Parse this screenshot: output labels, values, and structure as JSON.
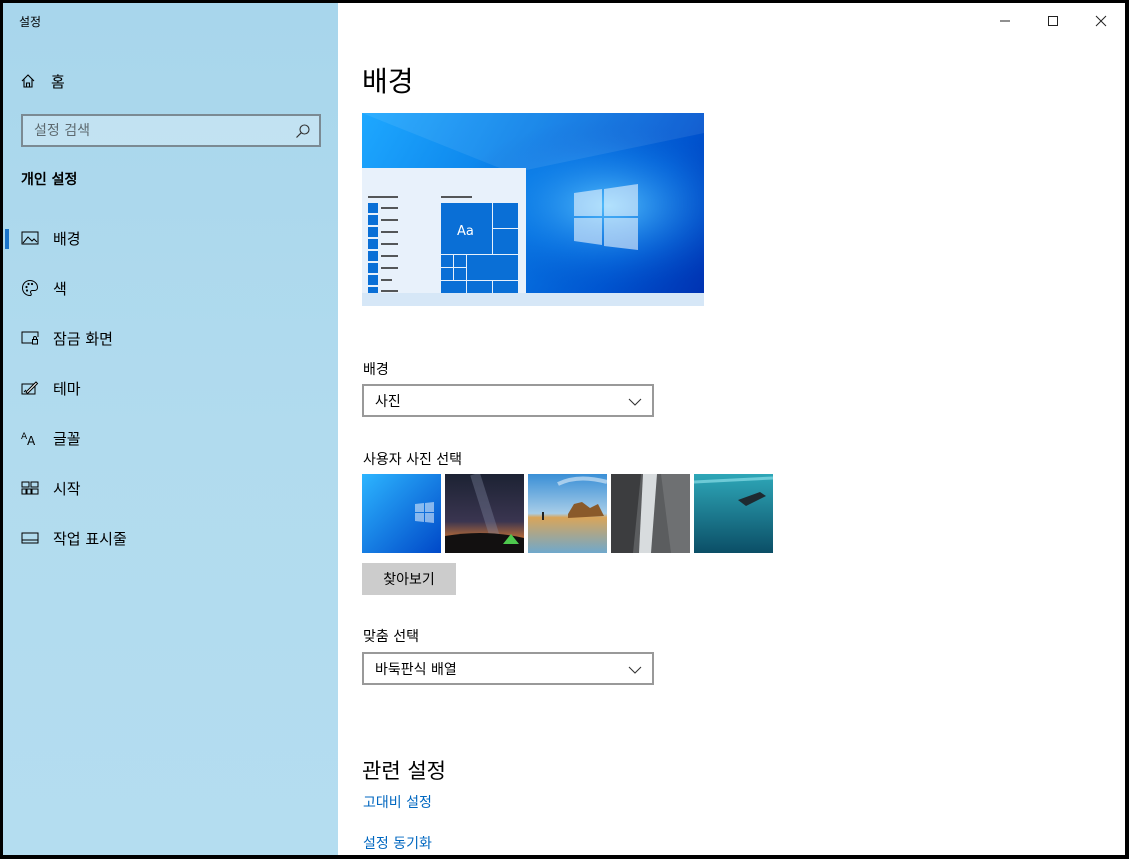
{
  "window": {
    "app_title": "설정",
    "minimize_glyph": "—",
    "maximize_glyph": "☐",
    "close_glyph": "✕"
  },
  "sidebar": {
    "home_label": "홈",
    "search_placeholder": "설정 검색",
    "section_title": "개인 설정",
    "items": [
      {
        "label": "배경",
        "icon": "picture-icon",
        "active": true
      },
      {
        "label": "색",
        "icon": "palette-icon",
        "active": false
      },
      {
        "label": "잠금 화면",
        "icon": "lock-screen-icon",
        "active": false
      },
      {
        "label": "테마",
        "icon": "theme-icon",
        "active": false
      },
      {
        "label": "글꼴",
        "icon": "font-icon",
        "active": false
      },
      {
        "label": "시작",
        "icon": "start-icon",
        "active": false
      },
      {
        "label": "작업 표시줄",
        "icon": "taskbar-icon",
        "active": false
      }
    ],
    "accent_color": "#1a73c8"
  },
  "main": {
    "page_title": "배경",
    "preview": {
      "tile_text": "Aa"
    },
    "background_label": "배경",
    "background_value": "사진",
    "choose_photo_label": "사용자 사진 선택",
    "photos": [
      "windows-blue-wallpaper",
      "milky-way-tent",
      "beach-rocks-sunset",
      "waterfall-cliff",
      "underwater-swimmer"
    ],
    "browse_label": "찾아보기",
    "fit_label": "맞춤 선택",
    "fit_value": "바둑판식 배열",
    "related_title": "관련 설정",
    "links": [
      "고대비 설정",
      "설정 동기화"
    ],
    "link_color": "#0067c0"
  }
}
